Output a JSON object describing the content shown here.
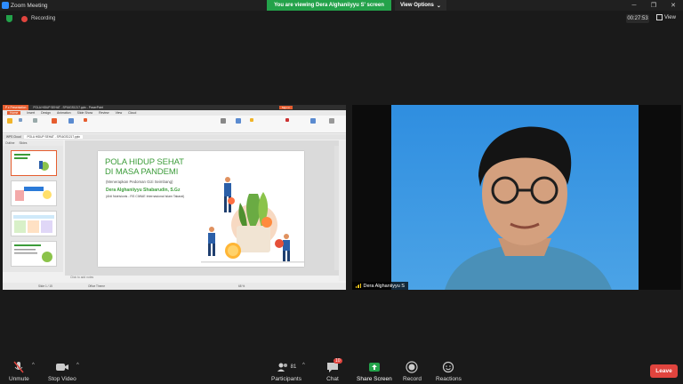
{
  "window": {
    "title": "Zoom Meeting"
  },
  "banner": {
    "viewing": "You are viewing Dera Alghaniiyyu S' screen",
    "view_options": "View Options"
  },
  "security": {
    "recording": "Recording"
  },
  "meeting": {
    "timer": "00:27:53",
    "view_label": "View"
  },
  "shared_screen": {
    "app_tab": "P ▾ Presentation",
    "doc_tab": "POLA HIDUP SEHAT - SP16GS1217.pptx - PowerPoint",
    "signin": "Sign in",
    "ribbon_tabs": [
      "Home",
      "Insert",
      "Design",
      "Animation",
      "Slide Show",
      "Review",
      "View",
      "Cloud"
    ],
    "doc_tabs": [
      "WPS Cloud",
      "POLA HIDUP SEHAT - SP16GS1217.pptx"
    ],
    "side_tabs": [
      "Outline",
      "Slides"
    ],
    "slide": {
      "title_line1": "POLA HIDUP SEHAT",
      "title_line2": "DI MASA PANDEMI",
      "subtitle": "(Menerapkan Pedoman Gizi Seimbang)",
      "author": "Dera Alghaniiyyu Shabarudin, S.Gz",
      "affiliation": "(Ahli Nutrisionis - RS CIWAE Internasional Islam Takaral)"
    },
    "notes_placeholder": "Click to add notes",
    "status": [
      "Slide 1 / 15",
      "Office Theme",
      "68 %"
    ]
  },
  "video": {
    "participant_name": "Dera Alghaniiyyu S"
  },
  "toolbar": {
    "unmute": "Unmute",
    "stop_video": "Stop Video",
    "participants": "Participants",
    "participants_count": "81",
    "chat": "Chat",
    "chat_badge": "10",
    "share_screen": "Share Screen",
    "record": "Record",
    "reactions": "Reactions",
    "leave": "Leave"
  },
  "colors": {
    "accent_green": "#23a24a",
    "leave_red": "#e0443e",
    "zoom_blue": "#2d8cff",
    "wps_orange": "#e65d2f"
  }
}
